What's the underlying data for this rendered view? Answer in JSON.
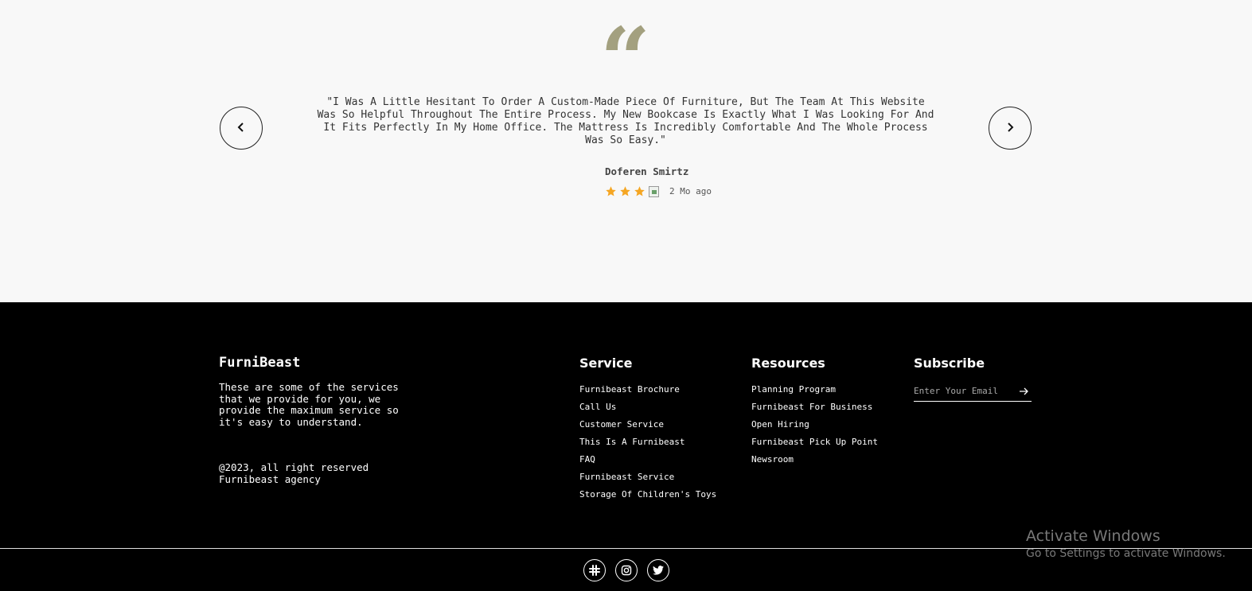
{
  "testimonial": {
    "quote_mark": "“",
    "text": "\"I Was A Little Hesitant To Order A Custom-Made Piece Of Furniture, But The Team At This Website Was So Helpful Throughout The Entire Process. My New Bookcase Is Exactly What I Was Looking For And It Fits Perfectly In My Home Office. The Mattress Is Incredibly Comfortable And The Whole Process Was So Easy.\"",
    "author": "Doferen Smirtz",
    "rating": 3,
    "time_ago": "2 Mo ago",
    "prev_icon": "chevron-left-icon",
    "next_icon": "chevron-right-icon",
    "star_color": "#f5a623",
    "quote_color": "#a3a07f"
  },
  "footer": {
    "brand": "FurniBeast",
    "description": "These are some of the services that we provide for you, we provide the maximum service so it's easy to understand.",
    "copyright_line1": "@2023, all right reserved",
    "copyright_line2": "Furnibeast agency",
    "service": {
      "title": "Service",
      "items": [
        "Furnibeast Brochure",
        "Call Us",
        "Customer Service",
        "This Is A Furnibeast",
        "FAQ",
        "Furnibeast Service",
        "Storage Of Children's Toys"
      ]
    },
    "resources": {
      "title": "Resources",
      "items": [
        "Planning Program",
        "Furnibeast For Business",
        "Open Hiring",
        "Furnibeast Pick Up Point",
        "Newsroom"
      ]
    },
    "subscribe": {
      "title": "Subscribe",
      "placeholder": "Enter Your Email",
      "submit_icon": "arrow-right-icon"
    },
    "socials": [
      "slack-icon",
      "instagram-icon",
      "twitter-icon"
    ]
  },
  "watermark": {
    "title": "Activate Windows",
    "subtitle": "Go to Settings to activate Windows."
  }
}
